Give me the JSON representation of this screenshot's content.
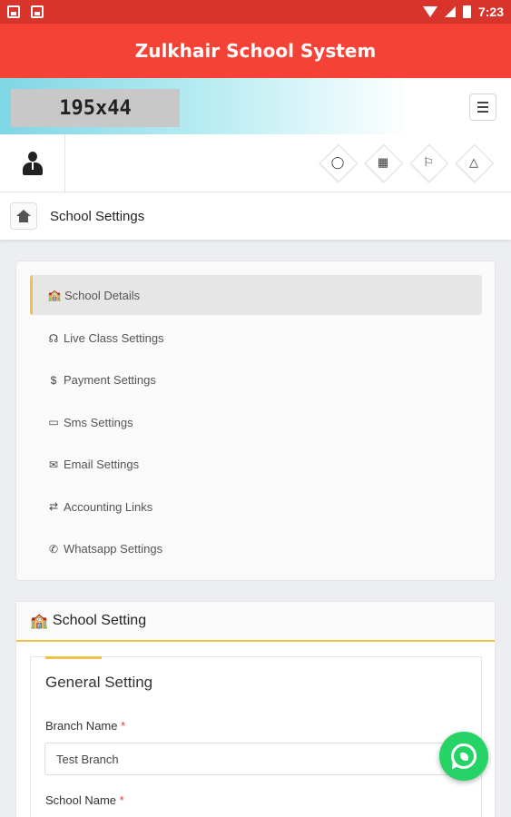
{
  "statusbar": {
    "time": "7:23"
  },
  "appbar": {
    "title": "Zulkhair School System"
  },
  "brand": {
    "logo_placeholder": "195x44"
  },
  "breadcrumb": {
    "current": "School Settings"
  },
  "quick_icons": [
    "globe-icon",
    "calendar-icon",
    "flag-icon",
    "bell-icon"
  ],
  "settings_menu": {
    "items": [
      {
        "label": "School Details",
        "icon": "school-icon",
        "active": true
      },
      {
        "label": "Live Class Settings",
        "icon": "headset-icon",
        "active": false
      },
      {
        "label": "Payment Settings",
        "icon": "dollar-icon",
        "active": false
      },
      {
        "label": "Sms Settings",
        "icon": "monitor-icon",
        "active": false
      },
      {
        "label": "Email Settings",
        "icon": "envelope-icon",
        "active": false
      },
      {
        "label": "Accounting Links",
        "icon": "shuffle-icon",
        "active": false
      },
      {
        "label": "Whatsapp Settings",
        "icon": "whatsapp-icon",
        "active": false
      }
    ]
  },
  "form": {
    "header": "School Setting",
    "section_title": "General Setting",
    "fields": [
      {
        "label": "Branch Name",
        "required_mark": "*",
        "value": "Test Branch"
      },
      {
        "label": "School Name",
        "required_mark": "*",
        "value": ""
      }
    ]
  },
  "colors": {
    "appbar": "#f44336",
    "statusbar": "#d8342b",
    "accent": "#f1c24a",
    "whatsapp": "#25d366"
  }
}
